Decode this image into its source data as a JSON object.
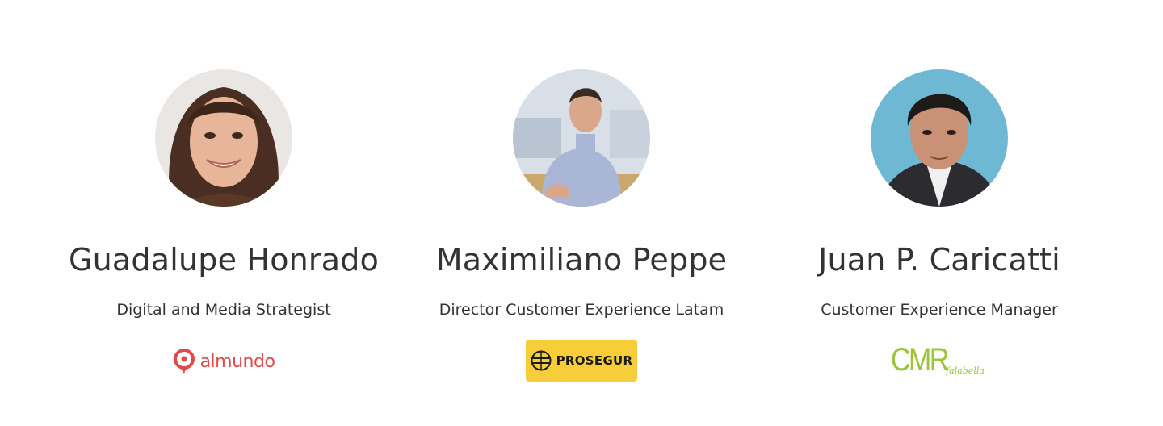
{
  "team": {
    "members": [
      {
        "name": "Guadalupe Honrado",
        "role": "Digital and Media Strategist",
        "logo": {
          "text": "almundo",
          "color": "#e24a4a",
          "icon": "almundo-pin-icon"
        }
      },
      {
        "name": "Maximiliano Peppe",
        "role": "Director Customer Experience Latam",
        "logo": {
          "text": "PROSEGUR",
          "color": "#f7cd3a",
          "icon": "prosegur-globe-icon"
        }
      },
      {
        "name": "Juan P. Caricatti",
        "role": "Customer Experience Manager",
        "logo": {
          "text": "CMR",
          "subtext": "falabella",
          "color": "#9cc43a"
        }
      }
    ]
  },
  "colors": {
    "text": "#333333",
    "background": "#ffffff"
  }
}
